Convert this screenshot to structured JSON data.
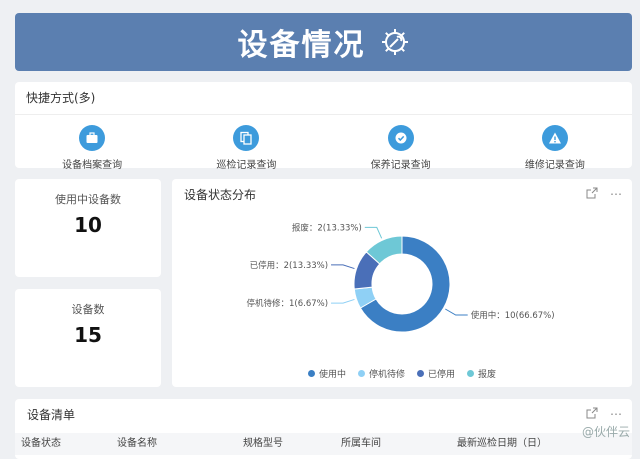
{
  "banner": {
    "title": "设备情况"
  },
  "quick": {
    "title": "快捷方式(多)",
    "items": [
      {
        "label": "设备档案查询",
        "icon": "briefcase-icon"
      },
      {
        "label": "巡检记录查询",
        "icon": "copy-icon"
      },
      {
        "label": "保养记录查询",
        "icon": "check-icon"
      },
      {
        "label": "维修记录查询",
        "icon": "warning-icon"
      }
    ]
  },
  "stats": [
    {
      "label": "使用中设备数",
      "value": "10"
    },
    {
      "label": "设备数",
      "value": "15"
    }
  ],
  "status_chart": {
    "title": "设备状态分布",
    "legend": [
      "使用中",
      "停机待修",
      "已停用",
      "报废"
    ]
  },
  "chart_data": {
    "type": "pie",
    "title": "设备状态分布",
    "categories": [
      "使用中",
      "停机待修",
      "已停用",
      "报废"
    ],
    "values": [
      10,
      1,
      2,
      2
    ],
    "data_labels": [
      "使用中：10(66.67%)",
      "停机待修：1(6.67%)",
      "已停用：2(13.33%)",
      "报废：2(13.33%)"
    ],
    "colors": [
      "#3b7fc4",
      "#8fd0f5",
      "#4a6fb8",
      "#6ec8d6"
    ],
    "legend": "bottom"
  },
  "equipment_list": {
    "title": "设备清单",
    "columns": [
      "设备状态",
      "设备名称",
      "规格型号",
      "所属车间",
      "最新巡检日期（日）"
    ]
  },
  "watermark": "@伙伴云",
  "colors": {
    "banner": "#5b7fb0",
    "accent": "#3d9bdc"
  }
}
